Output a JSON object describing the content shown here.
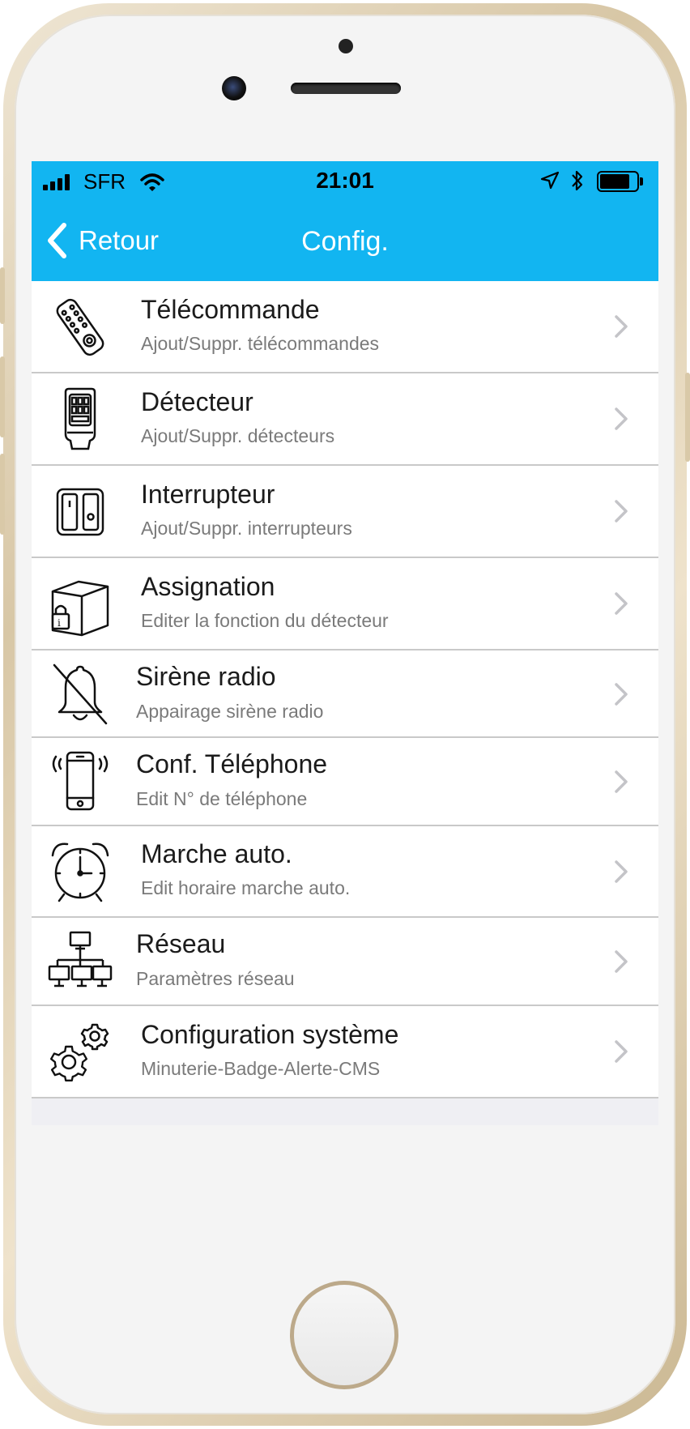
{
  "status_bar": {
    "carrier": "SFR",
    "time": "21:01"
  },
  "nav": {
    "back_label": "Retour",
    "title": "Config."
  },
  "menu": {
    "items": [
      {
        "title": "Télécommande",
        "subtitle": "Ajout/Suppr. télécommandes",
        "icon": "remote-control-icon"
      },
      {
        "title": "Détecteur",
        "subtitle": "Ajout/Suppr. détecteurs",
        "icon": "detector-icon"
      },
      {
        "title": "Interrupteur",
        "subtitle": "Ajout/Suppr. interrupteurs",
        "icon": "switch-icon"
      },
      {
        "title": "Assignation",
        "subtitle": "Editer la fonction du détecteur",
        "icon": "assignment-icon"
      },
      {
        "title": "Sirène radio",
        "subtitle": "Appairage sirène radio",
        "icon": "bell-off-icon"
      },
      {
        "title": "Conf. Téléphone",
        "subtitle": "Edit N° de téléphone",
        "icon": "phone-ringing-icon"
      },
      {
        "title": "Marche auto.",
        "subtitle": "Edit horaire marche auto.",
        "icon": "alarm-clock-icon"
      },
      {
        "title": "Réseau",
        "subtitle": "Paramètres réseau",
        "icon": "network-icon"
      },
      {
        "title": "Configuration système",
        "subtitle": "Minuterie-Badge-Alerte-CMS",
        "icon": "gears-icon"
      }
    ]
  },
  "colors": {
    "accent": "#12b5f1",
    "background": "#efeff3",
    "subtitle": "#7a7a7a",
    "divider": "#c9c9c9"
  }
}
